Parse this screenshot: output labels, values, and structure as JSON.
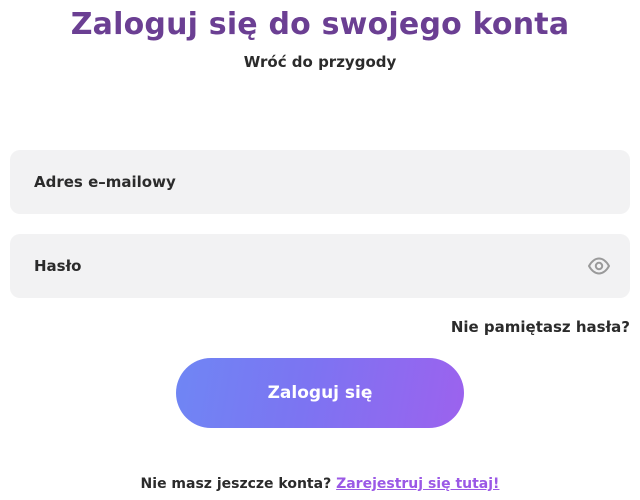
{
  "header": {
    "title": "Zaloguj się do swojego konta",
    "subtitle": "Wróć do przygody"
  },
  "form": {
    "email_placeholder": "Adres e–mailowy",
    "email_value": "",
    "password_placeholder": "Hasło",
    "password_value": "",
    "password_toggle_icon": "eye-icon",
    "forgot_link": "Nie pamiętasz hasła?",
    "submit_label": "Zaloguj się"
  },
  "footer": {
    "prompt": "Nie masz jeszcze konta?",
    "register_link": "Zarejestruj się tutaj!"
  },
  "colors": {
    "title": "#6b3f93",
    "text": "#2b2b2b",
    "field_bg": "#f2f2f3",
    "button_gradient_start": "#6f86f4",
    "button_gradient_end": "#9c62ee",
    "link": "#9b59e6"
  }
}
